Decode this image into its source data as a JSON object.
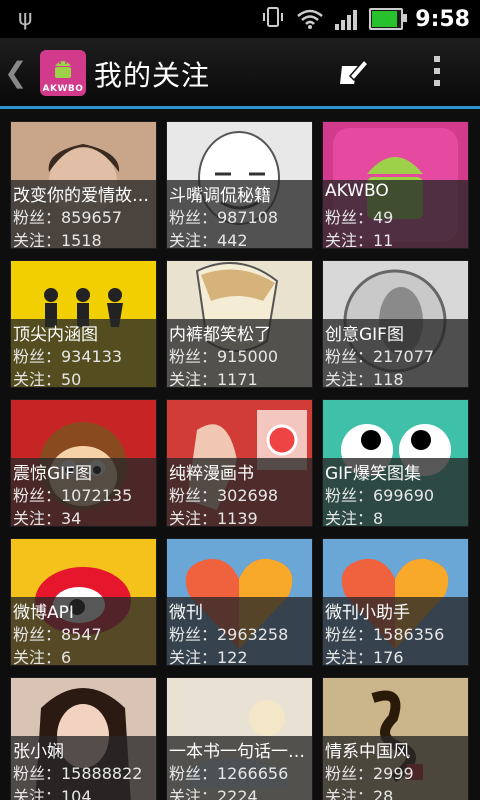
{
  "status_bar": {
    "time": "9:58",
    "battery_level": 0.95,
    "signal_bars": 4
  },
  "header": {
    "app_logo_text": "AKWBO",
    "title": "我的关注"
  },
  "labels": {
    "fans": "粉丝：",
    "follow": "关注："
  },
  "accounts": [
    {
      "name": "改变你的爱情故…",
      "fans": "859657",
      "follow": "1518",
      "thumb_bg": "#c9a58a",
      "icon": "face"
    },
    {
      "name": "斗嘴调侃秘籍",
      "fans": "987108",
      "follow": "442",
      "thumb_bg": "#e8e8e8",
      "icon": "meme"
    },
    {
      "name": "AKWBO",
      "fans": "49",
      "follow": "11",
      "thumb_bg": "#d23a8b",
      "icon": "android"
    },
    {
      "name": "顶尖内涵图",
      "fans": "934133",
      "follow": "50",
      "thumb_bg": "#f2cf00",
      "icon": "signs"
    },
    {
      "name": "内裤都笑松了",
      "fans": "915000",
      "follow": "1171",
      "thumb_bg": "#e9e2cf",
      "icon": "anime"
    },
    {
      "name": "创意GIF图",
      "fans": "217077",
      "follow": "118",
      "thumb_bg": "#d8d8d8",
      "icon": "coin"
    },
    {
      "name": "震惊GIF图",
      "fans": "1072135",
      "follow": "34",
      "thumb_bg": "#c72426",
      "icon": "monkey"
    },
    {
      "name": "纯粹漫画书",
      "fans": "302698",
      "follow": "1139",
      "thumb_bg": "#d23c36",
      "icon": "comic"
    },
    {
      "name": "GIF爆笑图集",
      "fans": "699690",
      "follow": "8",
      "thumb_bg": "#3fc0a8",
      "icon": "eyes"
    },
    {
      "name": "微博API",
      "fans": "8547",
      "follow": "6",
      "thumb_bg": "#f4c21b",
      "icon": "weibo"
    },
    {
      "name": "微刊",
      "fans": "2963258",
      "follow": "122",
      "thumb_bg": "#6aa6d6",
      "icon": "heart"
    },
    {
      "name": "微刊小助手",
      "fans": "1586356",
      "follow": "176",
      "thumb_bg": "#6aa6d6",
      "icon": "heart"
    },
    {
      "name": "张小娴",
      "fans": "15888822",
      "follow": "104",
      "thumb_bg": "#d9c3b4",
      "icon": "woman"
    },
    {
      "name": "一本书一句话一…",
      "fans": "1266656",
      "follow": "2224",
      "thumb_bg": "#e6dccd",
      "icon": "book"
    },
    {
      "name": "情系中国风",
      "fans": "2999",
      "follow": "28",
      "thumb_bg": "#cbb58a",
      "icon": "calligraphy"
    }
  ]
}
